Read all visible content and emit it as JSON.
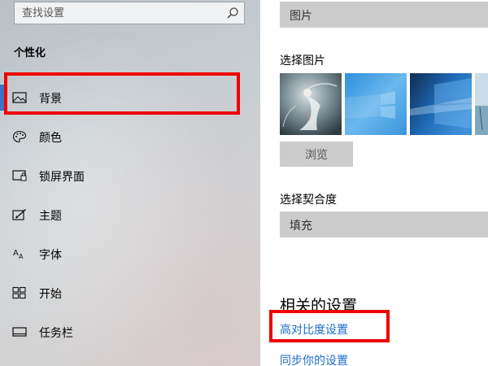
{
  "sidebar": {
    "search": {
      "placeholder": "查找设置",
      "icon": "search-icon"
    },
    "section_title": "个性化",
    "items": [
      {
        "label": "背景",
        "icon": "picture-icon",
        "selected": true
      },
      {
        "label": "颜色",
        "icon": "palette-icon",
        "selected": false
      },
      {
        "label": "锁屏界面",
        "icon": "lock-screen-icon",
        "selected": false
      },
      {
        "label": "主题",
        "icon": "theme-brush-icon",
        "selected": false
      },
      {
        "label": "字体",
        "icon": "font-icon",
        "selected": false
      },
      {
        "label": "开始",
        "icon": "start-grid-icon",
        "selected": false
      },
      {
        "label": "任务栏",
        "icon": "taskbar-icon",
        "selected": false
      }
    ]
  },
  "main": {
    "background_type_value": "图片",
    "choose_picture_label": "选择图片",
    "thumbnails": [
      "thumbnail-fairy",
      "thumbnail-windows-blue",
      "thumbnail-windows-light",
      "thumbnail-beach"
    ],
    "browse_label": "浏览",
    "choose_fit_label": "选择契合度",
    "fit_value": "填充",
    "related_heading": "相关的设置",
    "links": [
      "高对比度设置",
      "同步你的设置"
    ]
  },
  "colors": {
    "accent": "#3c72c8",
    "link": "#1a6ec8",
    "annotation_red": "#ee0000",
    "control_gray": "#cccccc"
  }
}
